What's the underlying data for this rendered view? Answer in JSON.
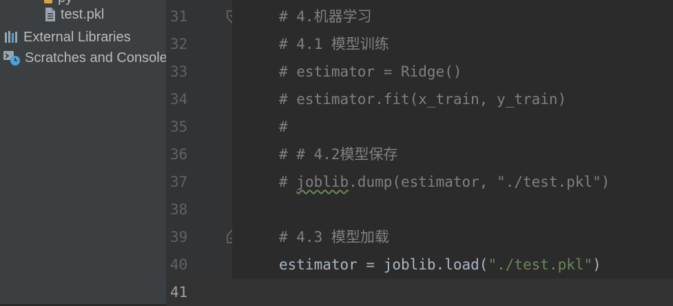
{
  "project_panel": {
    "partial_item_label": "py",
    "items": [
      {
        "label": "test.pkl",
        "icon": "text-file-icon"
      },
      {
        "label": "External Libraries",
        "icon": "library-icon"
      },
      {
        "label": "Scratches and Consoles",
        "icon": "scratches-icon"
      }
    ]
  },
  "editor": {
    "line_numbers": [
      "31",
      "32",
      "33",
      "34",
      "35",
      "36",
      "37",
      "38",
      "39",
      "40",
      "41"
    ],
    "current_line": "41",
    "lines": {
      "l31": "# 4.机器学习",
      "l32": "# 4.1 模型训练",
      "l33": "# estimator = Ridge()",
      "l34": "# estimator.fit(x_train, y_train)",
      "l35": "#",
      "l36": "# # 4.2模型保存",
      "l37_prefix": "# ",
      "l37_squiggle": "joblib",
      "l37_suffix": ".dump(estimator, \"./test.pkl\")",
      "l38": "",
      "l39": "# 4.3 模型加载",
      "l40_code": "estimator = joblib.load(",
      "l40_string": "\"./test.pkl\"",
      "l40_close": ")",
      "l41": ""
    }
  },
  "colors": {
    "background": "#2b2b2b",
    "panel": "#3c3f41",
    "gutter": "#313335",
    "comment": "#808080",
    "code": "#a9b7c6",
    "string": "#6a8759",
    "line_number": "#606366"
  }
}
